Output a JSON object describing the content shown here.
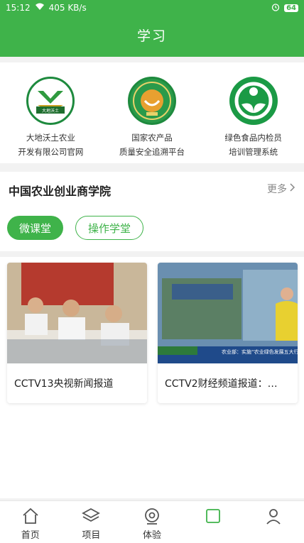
{
  "status_bar": {
    "time": "15:12",
    "network_speed": "405 KB/s",
    "battery": "64"
  },
  "header": {
    "title": "学习"
  },
  "partners": [
    {
      "icon": "dadi-wotu-logo-icon",
      "name_line1": "大地沃土农业",
      "name_line2": "开发有限公司官网",
      "logo_text": "大地沃土"
    },
    {
      "icon": "agri-product-traceability-logo-icon",
      "name_line1": "国家农产品",
      "name_line2": "质量安全追溯平台"
    },
    {
      "icon": "green-food-logo-icon",
      "name_line1": "绿色食品内检员",
      "name_line2": "培训管理系统"
    }
  ],
  "section": {
    "title": "中国农业创业商学院",
    "more_label": "更多",
    "tabs": [
      {
        "label": "微课堂",
        "active": true
      },
      {
        "label": "操作学堂",
        "active": false
      }
    ]
  },
  "cards": [
    {
      "caption": "CCTV13央视新闻报道"
    },
    {
      "caption": "CCTV2财经频道报道：…",
      "ticker_text": "农业部：实施“农业绿色发展五大行动”"
    }
  ],
  "bottom_nav": [
    {
      "label": "首页",
      "icon": "home-icon"
    },
    {
      "label": "项目",
      "icon": "layers-icon"
    },
    {
      "label": "体验",
      "icon": "experience-icon"
    }
  ],
  "colors": {
    "brand_green": "#3fb34a",
    "dark_green": "#1e8a3e"
  }
}
